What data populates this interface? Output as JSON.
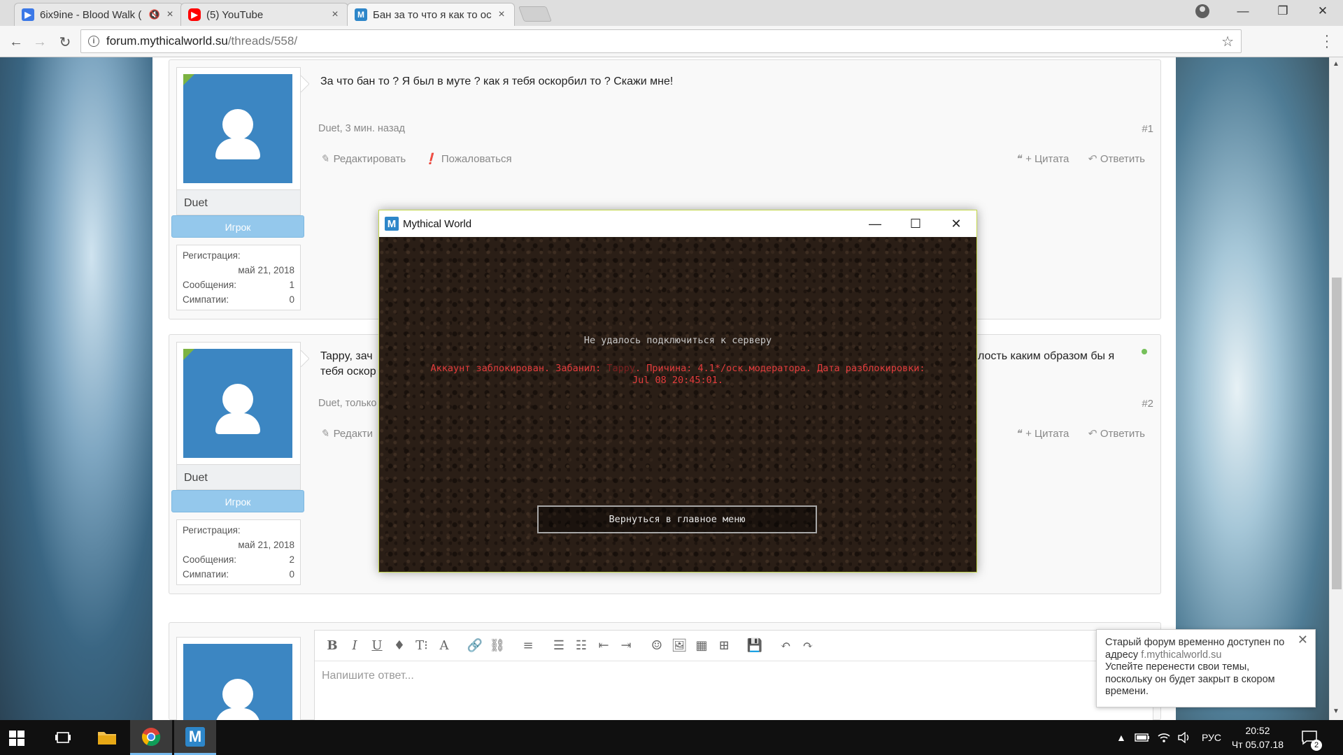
{
  "browser": {
    "tabs": [
      {
        "title": "6ix9ine - Blood Walk (",
        "favicon": "play-icon",
        "muted_icon": "🔇",
        "close": "×",
        "color": "#3b78e7"
      },
      {
        "title": "(5) YouTube",
        "favicon": "youtube-icon",
        "close": "×",
        "color": "#ff0000"
      },
      {
        "title": "Бан за то что я как то ос",
        "favicon": "mythical-icon",
        "favicon_letter": "M",
        "close": "×",
        "color": "#2d86c9",
        "active": true
      }
    ],
    "url_host": "forum.mythicalworld.su",
    "url_path": "/threads/558/",
    "window_controls": {
      "minimize": "—",
      "restore": "❐",
      "close": "✕"
    }
  },
  "posts": [
    {
      "username": "Duet",
      "role": "Игрок",
      "stats": [
        {
          "label": "Регистрация:",
          "value": ""
        },
        {
          "label": "",
          "value": "май 21, 2018"
        },
        {
          "label": "Сообщения:",
          "value": "1"
        },
        {
          "label": "Симпатии:",
          "value": "0"
        }
      ],
      "message": "За что бан то ? Я был в муте ? как я тебя оскорбил то ? Скажи мне!",
      "meta": "Duet, 3 мин. назад",
      "number": "#1",
      "edit": "Редактировать",
      "report": "Пожаловаться",
      "quote": "+ Цитата",
      "reply": "Ответить"
    },
    {
      "username": "Duet",
      "role": "Игрок",
      "stats": [
        {
          "label": "Регистрация:",
          "value": ""
        },
        {
          "label": "",
          "value": "май 21, 2018"
        },
        {
          "label": "Сообщения:",
          "value": "2"
        },
        {
          "label": "Симпатии:",
          "value": "0"
        }
      ],
      "message_start": "Tappy, зач",
      "message_end": "лость каким образом бы я",
      "message_line2": "тебя оскор",
      "meta": "Duet, только",
      "number": "#2",
      "edit": "Редакти",
      "quote": "+ Цитата",
      "reply": "Ответить"
    }
  ],
  "editor": {
    "placeholder": "Напишите ответ...",
    "tools": [
      "B",
      "I",
      "U",
      "♦",
      "T⁝",
      "A",
      "🔗",
      "⛓",
      "≡",
      "☰",
      "☷",
      "⇤",
      "⇥",
      "☺",
      "🖼",
      "▦",
      "⊞",
      "💾",
      "↶",
      "↷"
    ]
  },
  "notice": {
    "line1": "Старый форум временно доступен по адресу",
    "link": "f.mythicalworld.su",
    "line2": "Успейте перенести свои темы, поскольку он будет закрыт в скором времени.",
    "close": "✕"
  },
  "game": {
    "title": "Mythical World",
    "icon_letter": "M",
    "controls": {
      "minimize": "—",
      "maximize": "☐",
      "close": "✕"
    },
    "connect_error": "Не удалось подключиться к серверу",
    "ban_prefix": "Аккаунт заблокирован. Забанил: ",
    "ban_by": "Tappy",
    "ban_suffix": ". Причина: 4.1*/оск.модератора. Дата разблокировки: Jul 08 20:45:01.",
    "back_button": "Вернуться в главное меню"
  },
  "taskbar": {
    "lang": "РУС",
    "time": "20:52",
    "date": "Чт 05.07.18",
    "notifications": "2"
  }
}
